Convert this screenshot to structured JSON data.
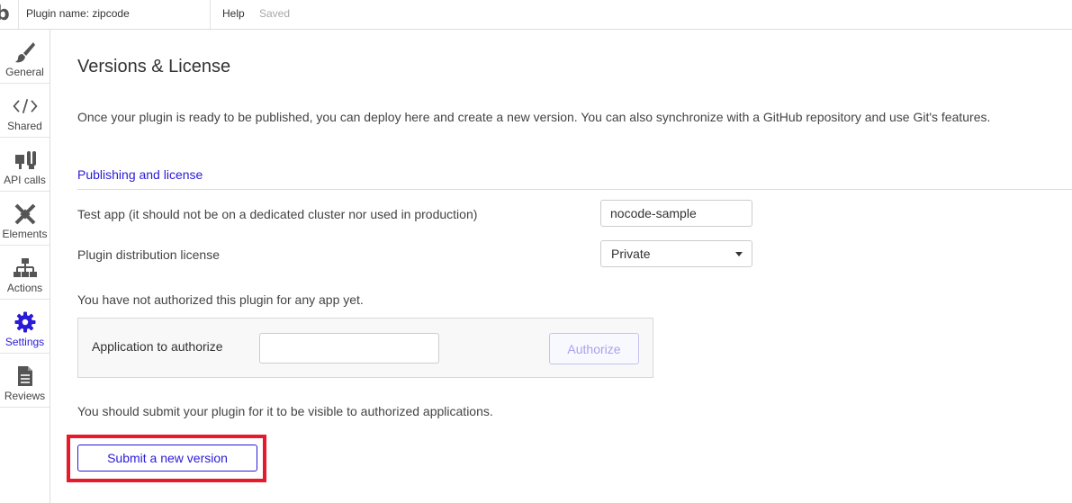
{
  "topbar": {
    "logo": "b",
    "plugin_name": "Plugin name: zipcode",
    "help": "Help",
    "status": "Saved"
  },
  "sidebar": {
    "items": [
      {
        "label": "General",
        "icon": "brush-icon"
      },
      {
        "label": "Shared",
        "icon": "code-icon"
      },
      {
        "label": "API calls",
        "icon": "plug-icon"
      },
      {
        "label": "Elements",
        "icon": "elements-icon"
      },
      {
        "label": "Actions",
        "icon": "sitemap-icon"
      },
      {
        "label": "Settings",
        "icon": "gear-icon",
        "active": true
      },
      {
        "label": "Reviews",
        "icon": "document-icon"
      }
    ]
  },
  "main": {
    "title": "Versions & License",
    "intro": "Once your plugin is ready to be published, you can deploy here and create a new version. You can also synchronize with a GitHub repository and use Git's features.",
    "section_title": "Publishing and license",
    "test_app_label": "Test app (it should not be on a dedicated cluster nor used in production)",
    "test_app_value": "nocode-sample",
    "license_label": "Plugin distribution license",
    "license_value": "Private",
    "not_authorized_text": "You have not authorized this plugin for any app yet.",
    "auth_label": "Application to authorize",
    "auth_value": "",
    "auth_button": "Authorize",
    "submit_text": "You should submit your plugin for it to be visible to authorized applications.",
    "submit_button": "Submit a new version"
  },
  "colors": {
    "accent": "#2a1bd6",
    "highlight": "#e8192a",
    "icon": "#555555"
  }
}
